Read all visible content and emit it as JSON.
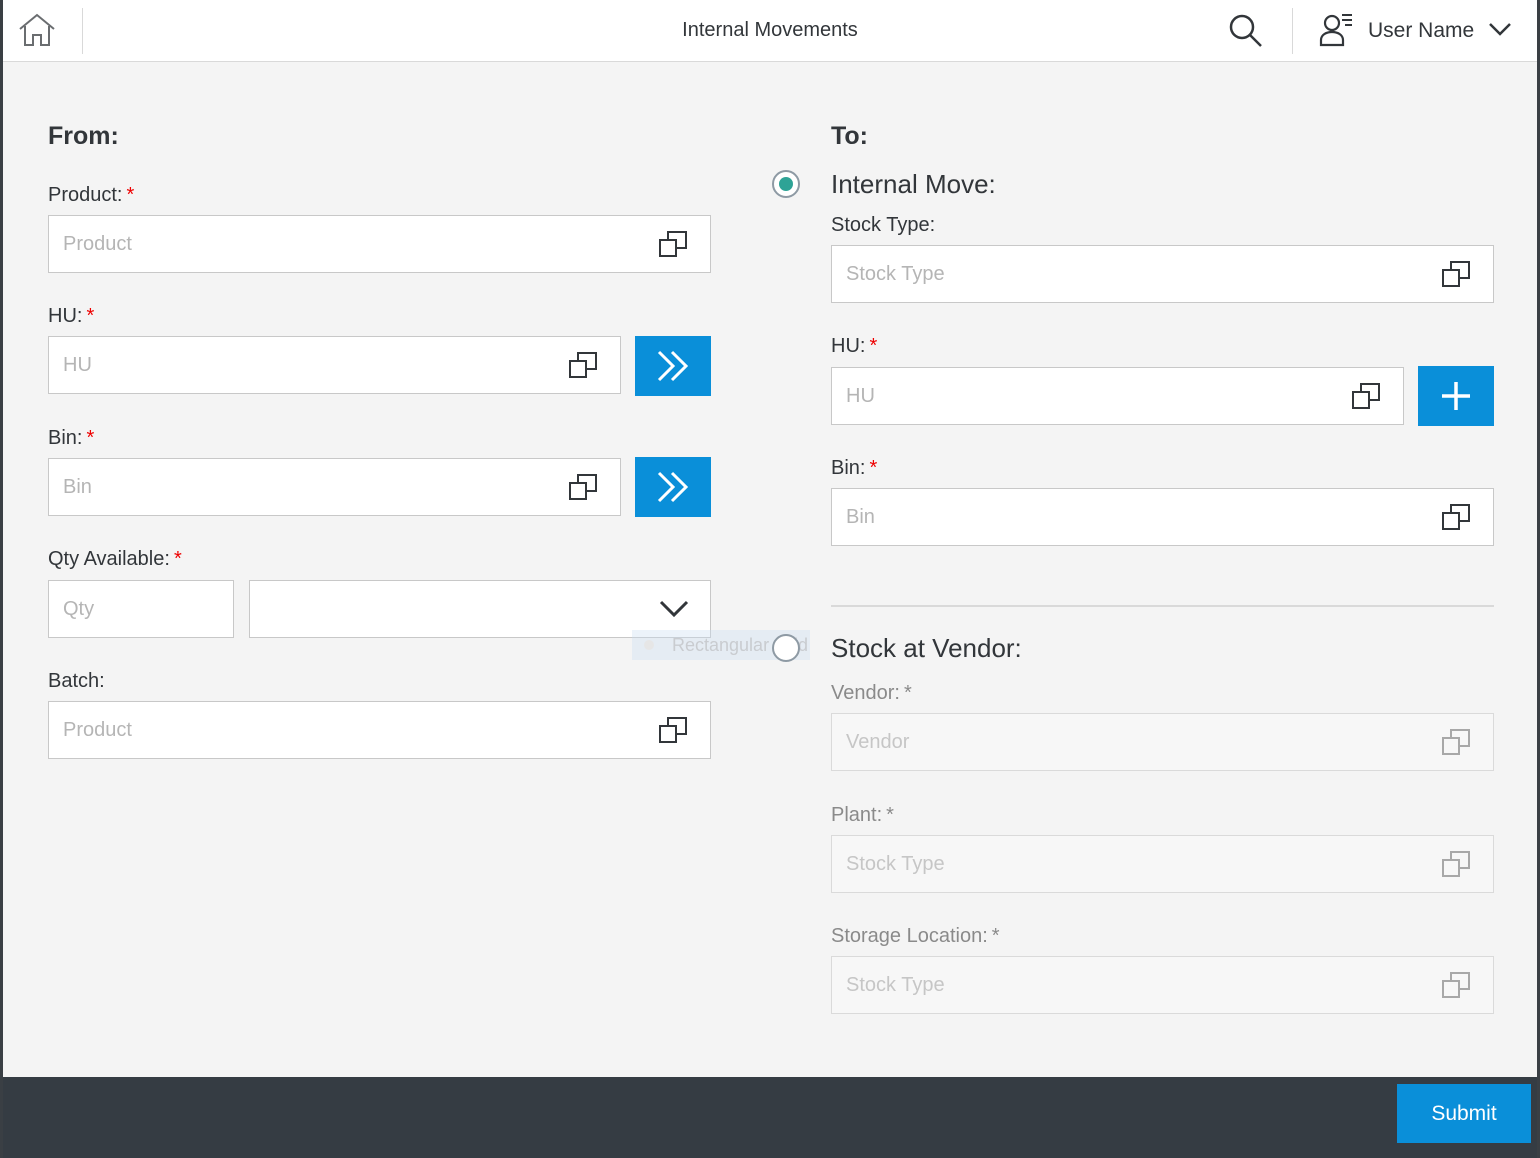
{
  "header": {
    "title": "Internal Movements",
    "user_name": "User Name"
  },
  "from": {
    "title": "From:",
    "product": {
      "label": "Product:",
      "required": "*",
      "placeholder": "Product"
    },
    "hu": {
      "label": "HU:",
      "required": "*",
      "placeholder": "HU"
    },
    "bin": {
      "label": "Bin:",
      "required": "*",
      "placeholder": "Bin"
    },
    "qty": {
      "label": "Qty Available:",
      "required": "*",
      "placeholder": "Qty",
      "unit_value": ""
    },
    "batch": {
      "label": "Batch:",
      "placeholder": "Product"
    }
  },
  "to": {
    "title": "To:",
    "internal_move": {
      "label": "Internal Move:",
      "selected": true,
      "stock_type": {
        "label": "Stock Type:",
        "placeholder": "Stock Type"
      },
      "hu": {
        "label": "HU:",
        "required": "*",
        "placeholder": "HU"
      },
      "bin": {
        "label": "Bin:",
        "required": "*",
        "placeholder": "Bin"
      }
    },
    "stock_at_vendor": {
      "label": "Stock at Vendor:",
      "selected": false,
      "vendor": {
        "label": "Vendor:",
        "required": "*",
        "placeholder": "Vendor"
      },
      "plant": {
        "label": "Plant:",
        "required": "*",
        "placeholder": "Stock Type"
      },
      "storage_location": {
        "label": "Storage Location:",
        "required": "*",
        "placeholder": "Stock Type"
      }
    }
  },
  "overlay": {
    "ghost_label": "Rectangular Grid"
  },
  "footer": {
    "submit_label": "Submit"
  },
  "colors": {
    "accent": "#0a8fd9",
    "radio_selected": "#2ea396",
    "footer_bg": "#353c43",
    "required": "#ee0000"
  },
  "icons": [
    "home-icon",
    "search-icon",
    "user-icon",
    "chevron-down-icon",
    "value-help-icon",
    "double-chevron-right-icon",
    "plus-icon"
  ]
}
